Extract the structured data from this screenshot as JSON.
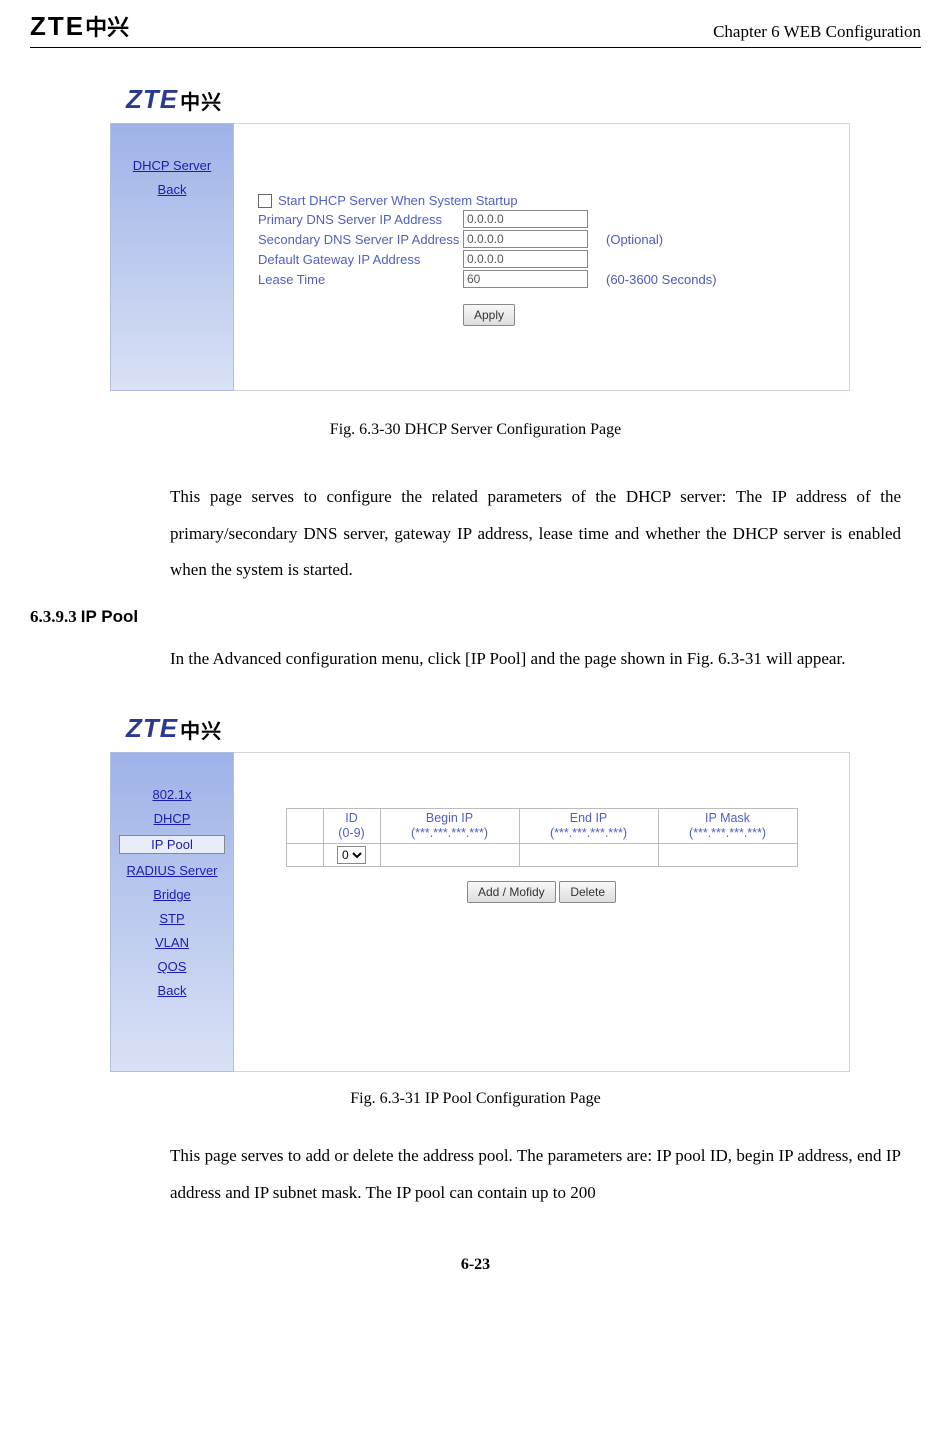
{
  "header": {
    "logo_text": "ZTE",
    "logo_cn": "中兴",
    "chapter": "Chapter 6 WEB Configuration"
  },
  "fig1": {
    "logo": "ZTE",
    "logo_cn": "中兴",
    "sidebar": {
      "item0": "DHCP Server",
      "item1": "Back"
    },
    "form": {
      "checkbox_label": "Start DHCP Server When System Startup",
      "primary_label": "Primary DNS Server IP Address",
      "primary_value": "0.0.0.0",
      "secondary_label": "Secondary DNS Server IP Address",
      "secondary_value": "0.0.0.0",
      "optional": "(Optional)",
      "gateway_label": "Default Gateway IP Address",
      "gateway_value": "0.0.0.0",
      "lease_label": "Lease Time",
      "lease_value": "60",
      "lease_hint": "(60-3600 Seconds)",
      "apply": "Apply"
    },
    "caption": "Fig. 6.3-30  DHCP Server Configuration Page"
  },
  "para1": "This page serves to configure the related parameters of the DHCP server: The IP address of the  primary/secondary DNS server, gateway IP address,  lease time and whether the DHCP server is enabled when the system is started.",
  "section": {
    "num": "6.3.9.3",
    "title": "IP Pool"
  },
  "para2": "In the Advanced configuration menu, click [IP Pool] and the page shown in Fig. 6.3-31 will appear.",
  "fig2": {
    "sidebar": {
      "i0": "802.1x",
      "i1": "DHCP",
      "i2": "IP Pool",
      "i3": "RADIUS Server",
      "i4": "Bridge",
      "i5": "STP",
      "i6": "VLAN",
      "i7": "QOS",
      "i8": "Back"
    },
    "table": {
      "h_id": "ID",
      "h_id_sub": "(0-9)",
      "h_begin": "Begin IP",
      "h_begin_sub": "(***.***.***.***)",
      "h_end": "End IP",
      "h_end_sub": "(***.***.***.***)",
      "h_mask": "IP Mask",
      "h_mask_sub": "(***.***.***.***)",
      "sel": "0"
    },
    "btn_add": "Add / Mofidy",
    "btn_del": "Delete",
    "caption": "Fig. 6.3-31   IP Pool Configuration Page"
  },
  "para3": "This page serves to add or delete the address pool. The parameters are:  IP pool ID, begin IP address, end IP address and IP subnet mask. The IP pool can contain up to 200",
  "page_number": "6-23"
}
